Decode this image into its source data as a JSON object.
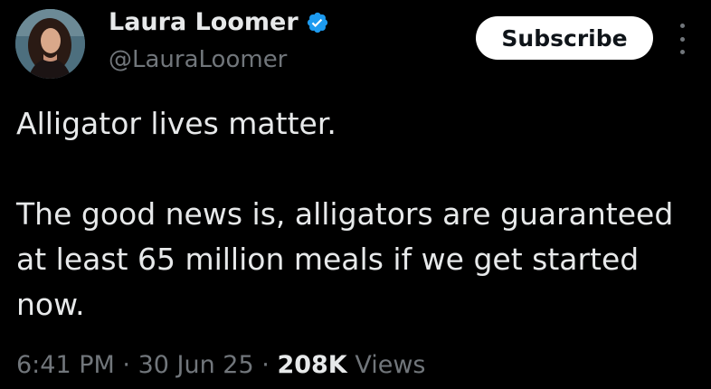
{
  "author": {
    "display_name": "Laura Loomer",
    "handle": "@LauraLoomer",
    "verified_icon": "verified-badge-icon",
    "avatar": "profile-photo"
  },
  "actions": {
    "subscribe_label": "Subscribe",
    "more_icon": "more-options-icon"
  },
  "tweet": {
    "paragraphs": [
      "Alligator lives matter.",
      "The good news is, alligators are guaranteed at least 65 million meals if we get started now."
    ]
  },
  "meta": {
    "time": "6:41 PM",
    "separator": "·",
    "date": "30 Jun 25",
    "views_count": "208K",
    "views_label": "Views"
  },
  "colors": {
    "background": "#000000",
    "text": "#e7e9ea",
    "muted": "#71767b",
    "verified": "#1d9bf0",
    "button_bg": "#ffffff"
  }
}
